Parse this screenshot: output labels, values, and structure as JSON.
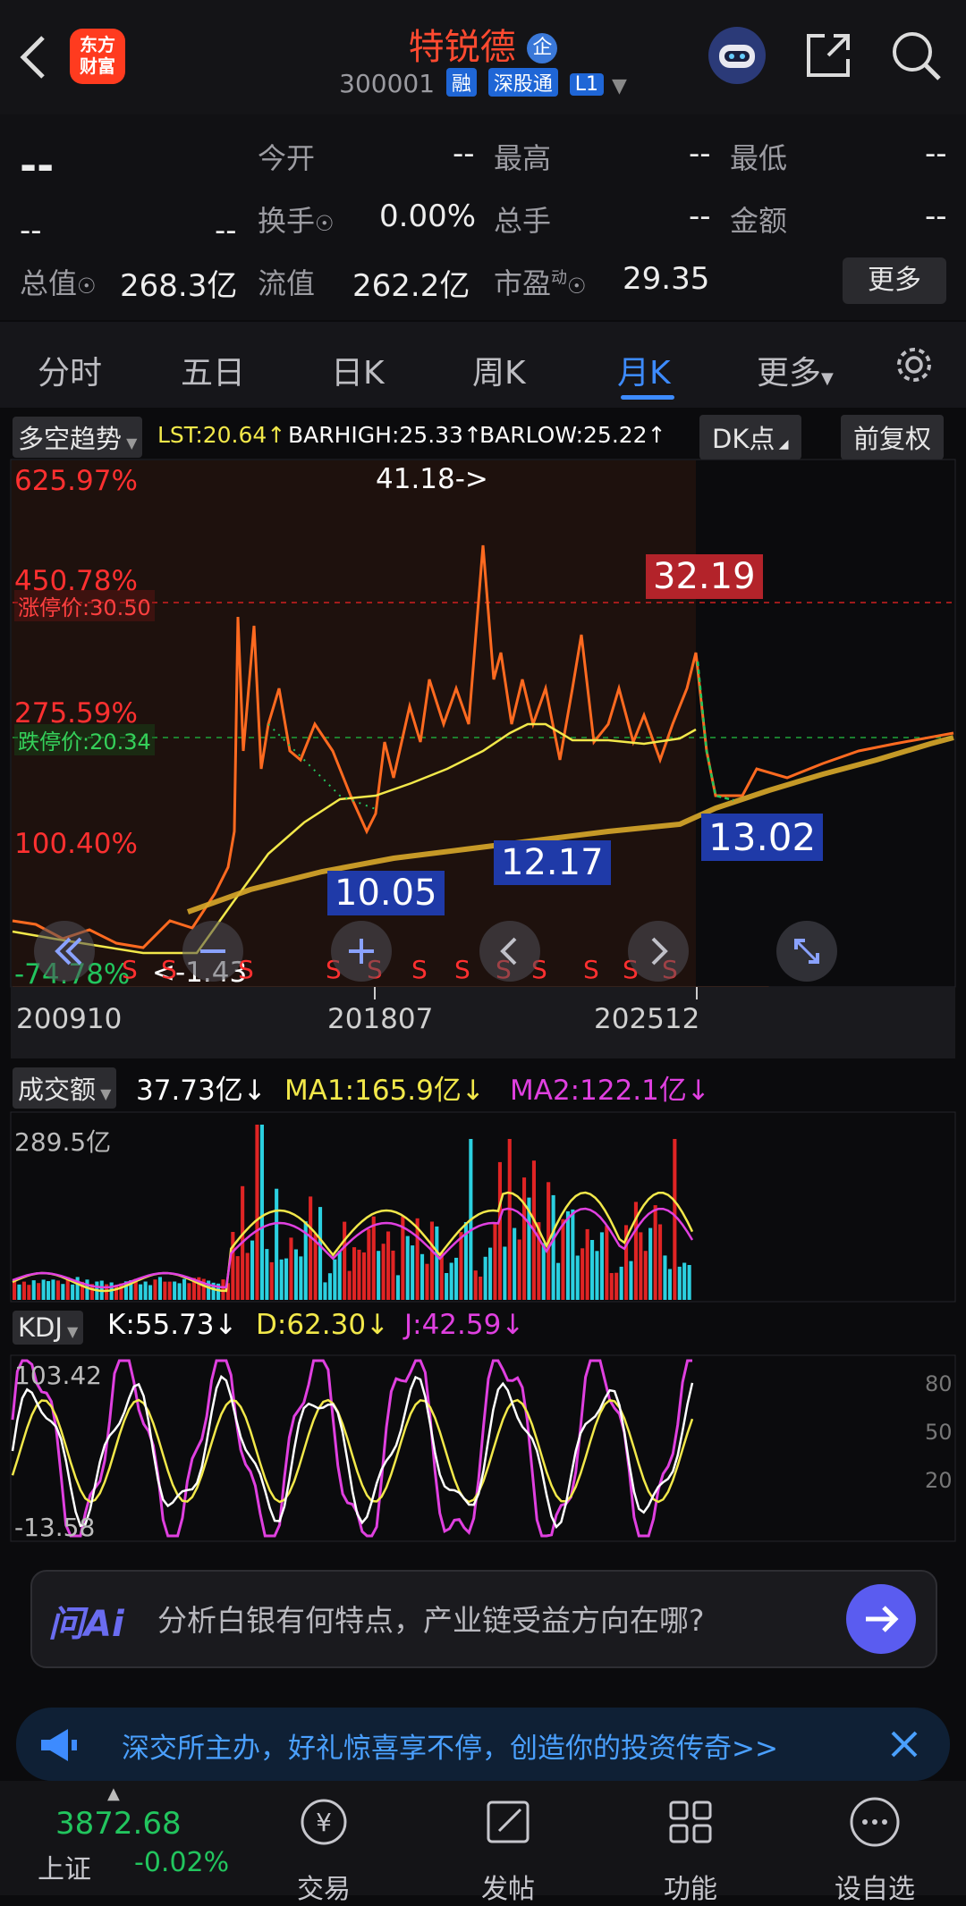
{
  "header": {
    "title": "特锐德",
    "title_badge": "企",
    "code": "300001",
    "tags": [
      "融",
      "深股通",
      "L1"
    ],
    "logo_text": "东方财富"
  },
  "quote": {
    "price": "--",
    "change": "--",
    "change_pct": "--",
    "rows": [
      {
        "label": "今开",
        "value": "--",
        "label2": "最高",
        "value2": "--",
        "label3": "最低",
        "value3": "--"
      },
      {
        "label": "换手",
        "value": "0.00%",
        "label2": "总手",
        "value2": "--",
        "label3": "金额",
        "value3": "--"
      }
    ],
    "total_value_label": "总值",
    "total_value": "268.3亿",
    "float_value_label": "流值",
    "float_value": "262.2亿",
    "pe_label": "市盈",
    "pe_superscript": "动",
    "pe_value": "29.35",
    "more_label": "更多"
  },
  "tabs": {
    "items": [
      "分时",
      "五日",
      "日K",
      "周K",
      "月K",
      "更多"
    ],
    "active": "月K"
  },
  "indicator_bar": {
    "selector": "多空趋势",
    "lst": "LST:20.64↑",
    "barhigh": "BARHIGH:25.33↑",
    "barlow": "BARLOW:25.22↑",
    "dk_label": "DK点",
    "adjust_label": "前复权"
  },
  "main_chart": {
    "pct_labels": [
      "625.97%",
      "450.78%",
      "275.59%",
      "100.40%",
      "-74.78%"
    ],
    "top_marker": "41.18->",
    "limit_up": "涨停价:30.50",
    "limit_down": "跌停价:20.34",
    "price_labels": {
      "high_box": "32.19",
      "label_a": "10.05",
      "label_b": "12.17",
      "label_c": "13.02",
      "low": "<-1.43"
    },
    "x_labels": [
      "200910",
      "201807",
      "202512"
    ],
    "s_marker": "S"
  },
  "volume": {
    "selector": "成交额",
    "value": "37.73亿↓",
    "ma1": "MA1:165.9亿↓",
    "ma2": "MA2:122.1亿↓",
    "max_label": "289.5亿"
  },
  "kdj": {
    "selector": "KDJ",
    "k": "K:55.73↓",
    "d": "D:62.30↓",
    "j": "J:42.59↓",
    "max_label": "103.42",
    "min_label": "-13.58",
    "levels": [
      "80",
      "50",
      "20"
    ]
  },
  "ai_bar": {
    "logo": "问Ai",
    "placeholder": "分析白银有何特点，产业链受益方向在哪?"
  },
  "promo": {
    "text": "深交所主办，好礼惊喜享不停，创造你的投资传奇>>"
  },
  "bottom_nav": {
    "index_value": "3872.68",
    "index_name": "上证",
    "index_change": "-0.02%",
    "items": [
      "交易",
      "发帖",
      "功能",
      "设自选"
    ]
  },
  "colors": {
    "red": "#ff3030",
    "green": "#22c55e",
    "blue": "#3d8bff",
    "yellow": "#f2e84a",
    "magenta": "#e040e0",
    "orange": "#ff7a30"
  }
}
